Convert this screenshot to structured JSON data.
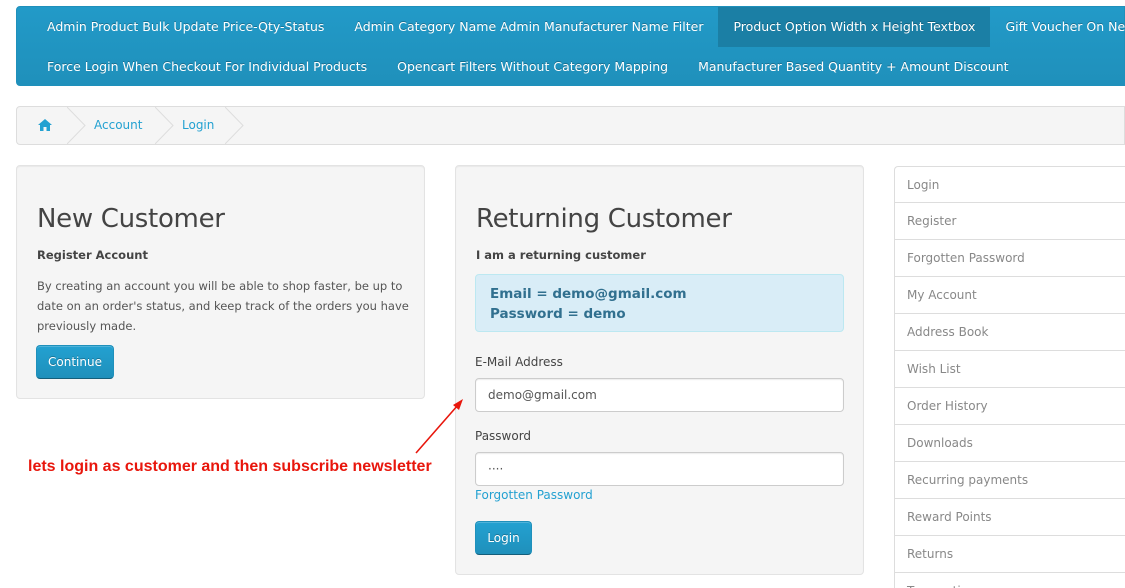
{
  "topnav": {
    "row1": [
      {
        "label": "Admin Product Bulk Update Price-Qty-Status"
      },
      {
        "label": "Admin Category Name Admin Manufacturer Name Filter"
      },
      {
        "label": "Product Option Width x Height Textbox"
      },
      {
        "label": "Gift Voucher On Newsletter"
      }
    ],
    "row2": [
      {
        "label": "Force Login When Checkout For Individual Products"
      },
      {
        "label": "Opencart Filters Without Category Mapping"
      },
      {
        "label": "Manufacturer Based Quantity + Amount Discount"
      }
    ]
  },
  "breadcrumb": {
    "icon": "home-icon",
    "items": [
      "Account",
      "Login"
    ]
  },
  "new_customer": {
    "title": "New Customer",
    "subtitle": "Register Account",
    "description": "By creating an account you will be able to shop faster, be up to date on an order's status, and keep track of the orders you have previously made.",
    "button": "Continue"
  },
  "returning_customer": {
    "title": "Returning Customer",
    "subtitle": "I am a returning customer",
    "alert_line1": "Email = demo@gmail.com",
    "alert_line2": "Password = demo",
    "email_label": "E-Mail Address",
    "email_value": "demo@gmail.com",
    "password_label": "Password",
    "password_value": "····",
    "forgotten_link": "Forgotten Password",
    "button": "Login"
  },
  "sidebar": {
    "items": [
      "Login",
      "Register",
      "Forgotten Password",
      "My Account",
      "Address Book",
      "Wish List",
      "Order History",
      "Downloads",
      "Recurring payments",
      "Reward Points",
      "Returns",
      "Transactions"
    ]
  },
  "annotation": {
    "text": "lets login as customer and then subscribe newsletter",
    "color": "#e8160c"
  },
  "colors": {
    "nav_bg": "#229ac8",
    "link": "#23a1d1",
    "alert_bg": "#d9edf7"
  }
}
